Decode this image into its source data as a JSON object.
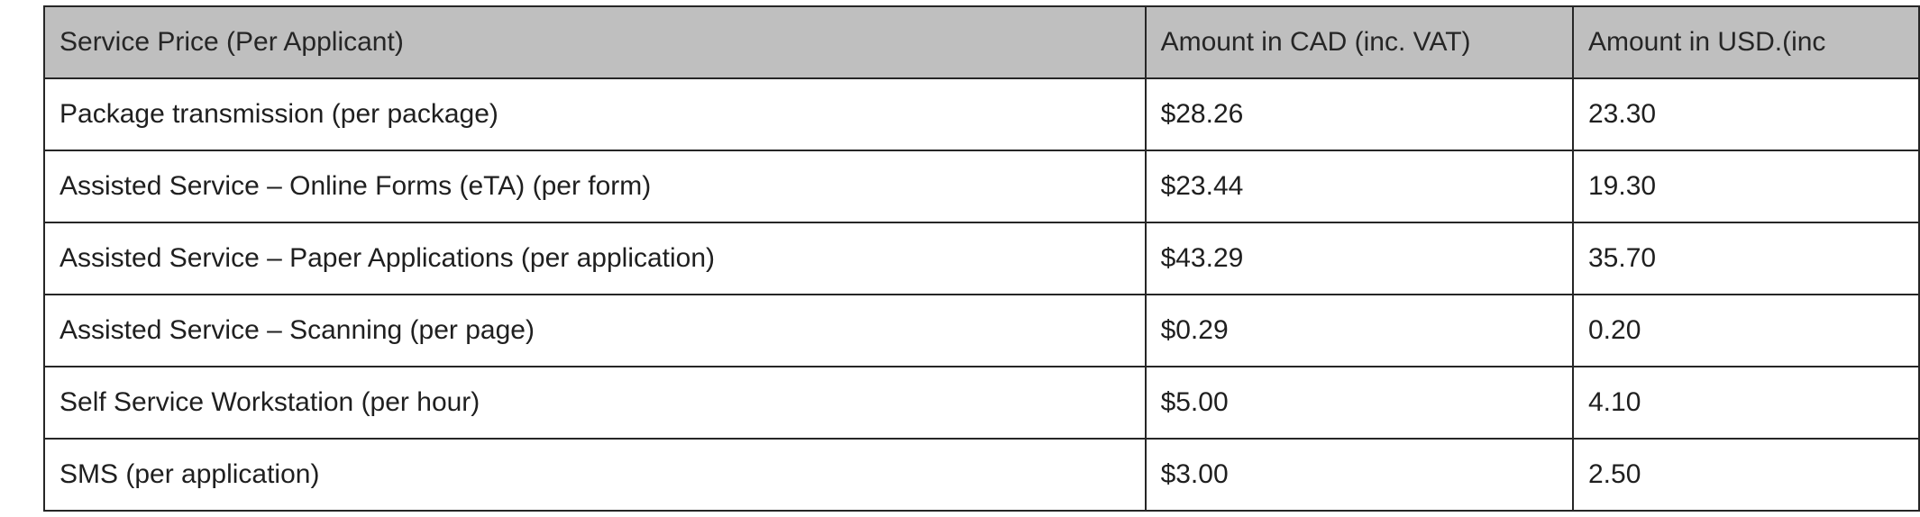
{
  "table": {
    "headers": [
      "Service Price (Per Applicant)",
      "Amount in CAD (inc. VAT)",
      "Amount in USD.(inc"
    ],
    "rows": [
      [
        "Package transmission (per package)",
        "$28.26",
        "23.30"
      ],
      [
        "Assisted Service – Online Forms (eTA) (per form)",
        "$23.44",
        "19.30"
      ],
      [
        "Assisted Service – Paper Applications (per application)",
        "$43.29",
        "35.70"
      ],
      [
        "Assisted Service – Scanning (per page)",
        "$0.29",
        "0.20"
      ],
      [
        "Self Service Workstation (per hour)",
        "$5.00",
        "4.10"
      ],
      [
        "SMS (per application)",
        "$3.00",
        "2.50"
      ]
    ]
  },
  "colors": {
    "header_bg": "#bfbfbf",
    "border": "#262626",
    "text": "#1f1f1f"
  }
}
